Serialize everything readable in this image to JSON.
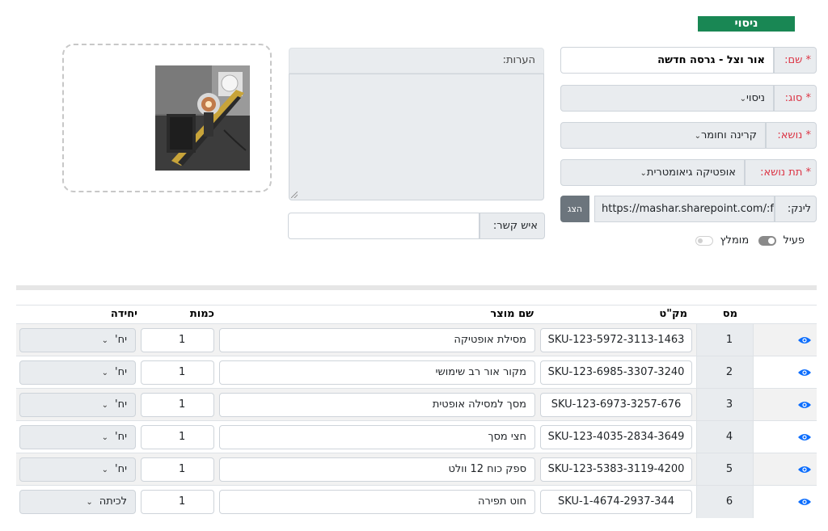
{
  "header": {
    "title": "ניסוי"
  },
  "form": {
    "name_label": "שם:",
    "name_value": "אור וצל - גרסה חדשה",
    "type_label": "סוג:",
    "type_value": "ניסוי",
    "topic_label": "נושא:",
    "topic_value": "קרינה וחומר",
    "subtopic_label": "תת נושא:",
    "subtopic_value": "אופטיקה גיאומטרית",
    "link_label": "לינק:",
    "link_value": "https://mashar.sharepoint.com/:f:",
    "show_button": "הצג",
    "active_label": "פעיל",
    "recommended_label": "מומלץ",
    "required_mark": "*",
    "notes_label": "הערות:",
    "notes_value": "",
    "contact_label": "איש קשר:",
    "contact_value": ""
  },
  "table": {
    "headers": {
      "num": "מס",
      "sku": "מק\"ט",
      "product": "שם מוצר",
      "qty": "כמות",
      "unit": "יחידה"
    },
    "rows": [
      {
        "num": "1",
        "sku": "SKU-123-5972-3113-1463",
        "product": "מסילת אופטיקה",
        "qty": "1",
        "unit": "יח'"
      },
      {
        "num": "2",
        "sku": "SKU-123-6985-3307-3240",
        "product": "מקור אור רב שימושי",
        "qty": "1",
        "unit": "יח'"
      },
      {
        "num": "3",
        "sku": "SKU-123-6973-3257-676",
        "product": "מסך למסילה אופטית",
        "qty": "1",
        "unit": "יח'"
      },
      {
        "num": "4",
        "sku": "SKU-123-4035-2834-3649",
        "product": "חצי מסך",
        "qty": "1",
        "unit": "יח'"
      },
      {
        "num": "5",
        "sku": "SKU-123-5383-3119-4200",
        "product": "ספק כוח 12 וולט",
        "qty": "1",
        "unit": "יח'"
      },
      {
        "num": "6",
        "sku": "SKU-1-4674-2937-344",
        "product": "חוט תפירה",
        "qty": "1",
        "unit": "לכיתה"
      }
    ]
  },
  "colors": {
    "title_bg": "#198754",
    "required": "#dc3545",
    "eye": "#0d6efd"
  }
}
